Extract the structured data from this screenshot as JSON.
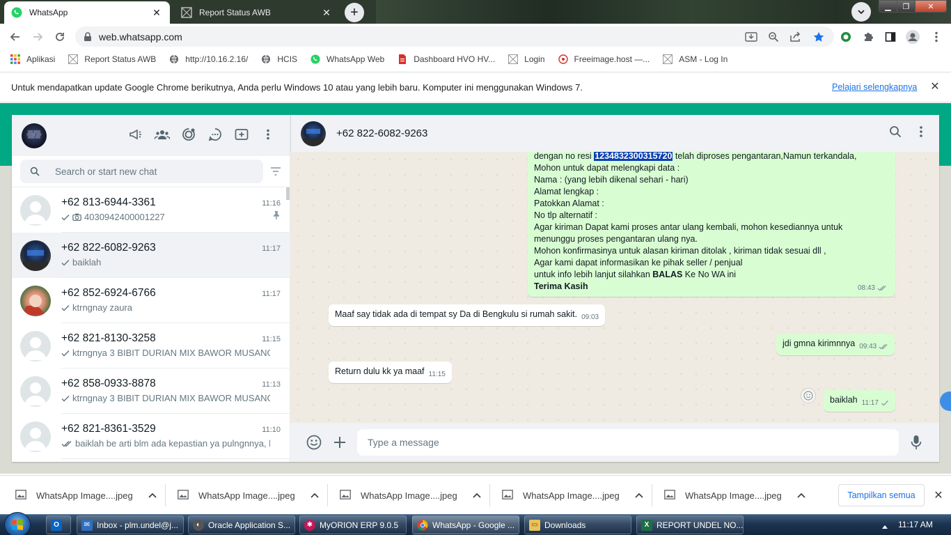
{
  "browser": {
    "tabs": [
      {
        "title": "WhatsApp",
        "active": true
      },
      {
        "title": "Report Status AWB",
        "active": false
      }
    ],
    "url": "web.whatsapp.com",
    "bookmarks": [
      "Aplikasi",
      "Report Status AWB",
      "http://10.16.2.16/",
      "HCIS",
      "WhatsApp Web",
      "Dashboard HVO HV...",
      "Login",
      "Freeimage.host —...",
      "ASM - Log In"
    ],
    "infobar": {
      "message": "Untuk mendapatkan update Google Chrome berikutnya, Anda perlu Windows 10 atau yang lebih baru. Komputer ini menggunakan Windows 7.",
      "link": "Pelajari selengkapnya"
    }
  },
  "whatsapp": {
    "search_placeholder": "Search or start new chat",
    "chats": [
      {
        "name": "+62 813-6944-3361",
        "time": "11:16",
        "preview": "4030942400001227",
        "pinned": true
      },
      {
        "name": "+62 822-6082-9263",
        "time": "11:17",
        "preview": "baiklah"
      },
      {
        "name": "+62 852-6924-6766",
        "time": "11:17",
        "preview": "ktrngnay zaura"
      },
      {
        "name": "+62 821-8130-3258",
        "time": "11:15",
        "preview": "ktrngnya 3 BIBIT DURIAN MIX BAWOR MUSANG K..."
      },
      {
        "name": "+62 858-0933-8878",
        "time": "11:13",
        "preview": "ktrngnay 3 BIBIT DURIAN MIX BAWOR MUSANG K..."
      },
      {
        "name": "+62 821-8361-3529",
        "time": "11:10",
        "preview": "baiklah be arti blm ada kepastian ya pulngnnya, k..."
      }
    ],
    "conversation": {
      "contact": "+62 822-6082-9263",
      "long_message": {
        "pre": "dengan no resi ",
        "highlight": "1234832300315720",
        "post": " telah diproses pengantaran,Namun terkandala,",
        "lines": [
          "Mohon untuk dapat melengkapi data :",
          "Nama : (yang lebih dikenal sehari - hari)",
          "Alamat  lengkap :",
          "Patokkan Alamat :",
          "No tlp alternatif :",
          "Agar kiriman Dapat kami proses antar ulang kembali, mohon kesediannya untuk",
          "menunggu proses pengantaran ulang nya.",
          "Mohon konfirmasinya untuk alasan kiriman ditolak , kiriman tidak sesuai dll ,",
          "Agar kami dapat informasikan ke pihak seller / penjual"
        ],
        "info_pre": "untuk info lebih lanjut silahkan ",
        "info_bold": "BALAS",
        "info_post": " Ke No WA ini",
        "closing": "Terima Kasih",
        "time": "08:43"
      },
      "messages": [
        {
          "dir": "in",
          "text": "Maaf say tidak ada di tempat sy Da di Bengkulu si rumah sakit.",
          "time": "09:03"
        },
        {
          "dir": "out",
          "text": "jdi gmna kirimnnya",
          "time": "09:43"
        },
        {
          "dir": "in",
          "text": "Return dulu kk ya maaf",
          "time": "11:15"
        },
        {
          "dir": "out",
          "text": "baiklah",
          "time": "11:17"
        }
      ]
    },
    "composer_placeholder": "Type a message"
  },
  "downloads": {
    "items": [
      "WhatsApp Image....jpeg",
      "WhatsApp Image....jpeg",
      "WhatsApp Image....jpeg",
      "WhatsApp Image....jpeg",
      "WhatsApp Image....jpeg"
    ],
    "show_all": "Tampilkan semua"
  },
  "taskbar": {
    "items": [
      "Inbox - plm.undel@j...",
      "Oracle Application S...",
      "MyORION ERP 9.0.5",
      "WhatsApp - Google ...",
      "Downloads",
      "REPORT UNDEL NO..."
    ],
    "clock": "11:17 AM"
  },
  "colors": {
    "wa_green": "#00a884",
    "outgoing_bubble": "#d9fdd3",
    "chrome_blue": "#1a73e8"
  }
}
